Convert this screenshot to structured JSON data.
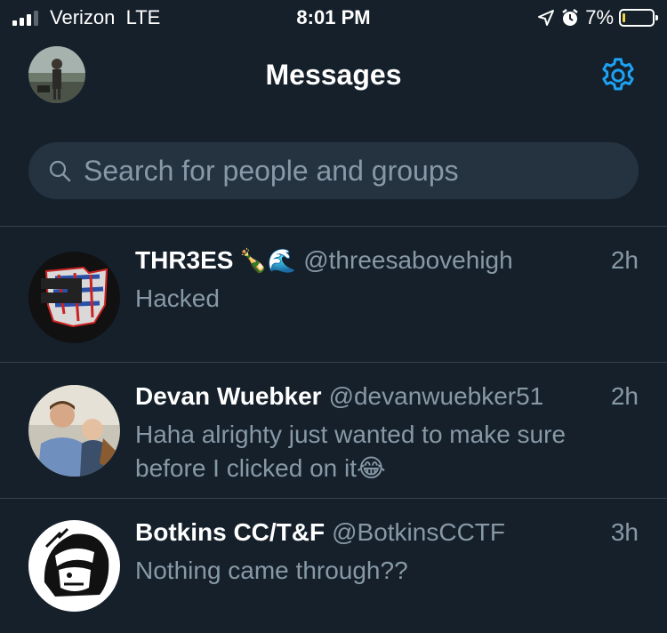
{
  "status_bar": {
    "carrier": "Verizon  LTE",
    "time": "8:01 PM",
    "battery": "7%"
  },
  "header": {
    "title": "Messages"
  },
  "search": {
    "placeholder": "Search for people and groups"
  },
  "conversations": [
    {
      "name": "THR3ES",
      "emoji": "🍾🌊",
      "handle": "@threesabovehigh",
      "time": "2h",
      "preview": "Hacked"
    },
    {
      "name": "Devan Wuebker",
      "emoji": "",
      "handle": "@devanwuebker51",
      "time": "2h",
      "preview": "Haha alrighty just wanted to make sure before I clicked on it😂"
    },
    {
      "name": "Botkins CC/T&F",
      "emoji": "",
      "handle": "@BotkinsCCTF",
      "time": "3h",
      "preview": "Nothing came through??"
    }
  ],
  "colors": {
    "background": "#15202b",
    "accent": "#1da1f2",
    "secondary_text": "#8899a6",
    "search_bg": "#253341"
  },
  "icons": [
    "signal-bars-icon",
    "location-arrow-icon",
    "alarm-clock-icon",
    "battery-icon",
    "gear-icon",
    "search-icon"
  ]
}
